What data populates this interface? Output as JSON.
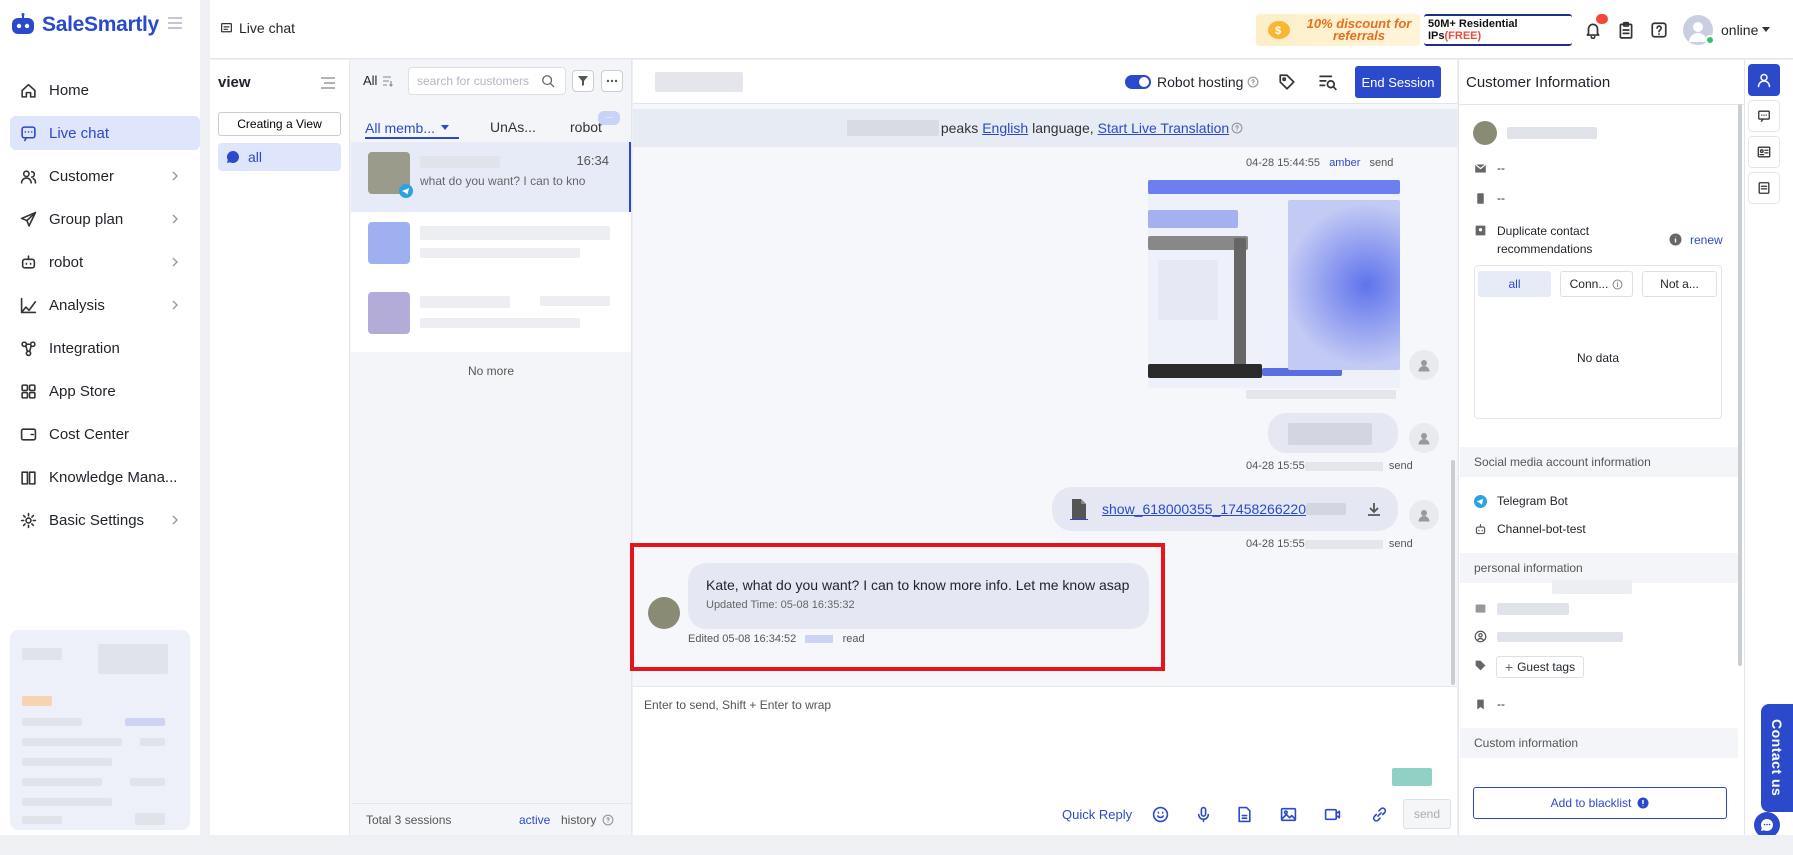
{
  "app": {
    "brand": "SaleSmartly"
  },
  "sidebar": {
    "items": [
      {
        "label": "Home",
        "icon": "home-icon",
        "has_submenu": false,
        "active": false
      },
      {
        "label": "Live chat",
        "icon": "chat-icon",
        "has_submenu": false,
        "active": true
      },
      {
        "label": "Customer",
        "icon": "users-icon",
        "has_submenu": true,
        "active": false
      },
      {
        "label": "Group plan",
        "icon": "send-icon",
        "has_submenu": true,
        "active": false
      },
      {
        "label": "robot",
        "icon": "robot-icon",
        "has_submenu": true,
        "active": false
      },
      {
        "label": "Analysis",
        "icon": "chart-icon",
        "has_submenu": true,
        "active": false
      },
      {
        "label": "Integration",
        "icon": "integration-icon",
        "has_submenu": false,
        "active": false
      },
      {
        "label": "App Store",
        "icon": "grid-icon",
        "has_submenu": false,
        "active": false
      },
      {
        "label": "Cost Center",
        "icon": "wallet-icon",
        "has_submenu": false,
        "active": false
      },
      {
        "label": "Knowledge Mana...",
        "icon": "book-icon",
        "has_submenu": false,
        "active": false
      },
      {
        "label": "Basic Settings",
        "icon": "gear-icon",
        "has_submenu": true,
        "active": false
      }
    ]
  },
  "header": {
    "title": "Live chat",
    "referral_text": "10% discount for referrals",
    "proxy_text_main": "50M+ Residential IPs",
    "proxy_text_free": "(FREE)",
    "status": "online"
  },
  "views": {
    "title": "view",
    "create_label": "Creating a View",
    "items": [
      {
        "label": "all"
      }
    ]
  },
  "sessions": {
    "filter_label": "All",
    "search_placeholder": "search for customers",
    "tabs": [
      {
        "label": "All memb..."
      },
      {
        "label": "UnAs..."
      },
      {
        "label": "robot"
      }
    ],
    "more_tabs": "...",
    "list": [
      {
        "time": "16:34",
        "preview": "what do you want? I can to kno"
      }
    ],
    "no_more": "No more",
    "total": "Total 3 sessions",
    "active_label": "active",
    "history_label": "history"
  },
  "chat": {
    "robot_hosting_label": "Robot hosting",
    "end_session_label": "End Session",
    "translate": {
      "prefix": "peaks",
      "language": "English",
      "middle": "language,",
      "action": "Start Live Translation"
    },
    "messages": [
      {
        "meta_time": "04-28 15:44:55",
        "meta_agent": "amber",
        "meta_status": "send"
      },
      {
        "meta_time": "04-28 15:55",
        "meta_status": "send"
      },
      {
        "file_name": "show_618000355_17458266220",
        "meta_time": "04-28 15:55",
        "meta_status": "send"
      }
    ],
    "customer_message": {
      "text": "Kate, what do you want? I can to know more info. Let me know asap",
      "updated": "Updated Time: 05-08 16:35:32",
      "edited": "Edited 05-08 16:34:52",
      "status": "read"
    },
    "composer_placeholder": "Enter to send, Shift + Enter to wrap",
    "quick_reply_label": "Quick Reply",
    "send_label": "send"
  },
  "customer_info": {
    "title": "Customer Information",
    "email": "--",
    "phone": "--",
    "duplicate_label": "Duplicate contact recommendations",
    "renew_label": "renew",
    "dup_tabs": [
      "all",
      "Conn...",
      "Not a..."
    ],
    "no_data": "No data",
    "social_section": "Social media account information",
    "social_platform": "Telegram Bot",
    "social_channel": "Channel-bot-test",
    "personal_section": "personal information",
    "guest_tags_label": "Guest tags",
    "bookmark_value": "--",
    "custom_section": "Custom information",
    "blacklist_label": "Add to blacklist"
  },
  "widget": {
    "contact_label": "Contact us"
  },
  "colors": {
    "accent": "#2b4acb",
    "highlight": "#e8141b",
    "online": "#36c26a"
  }
}
